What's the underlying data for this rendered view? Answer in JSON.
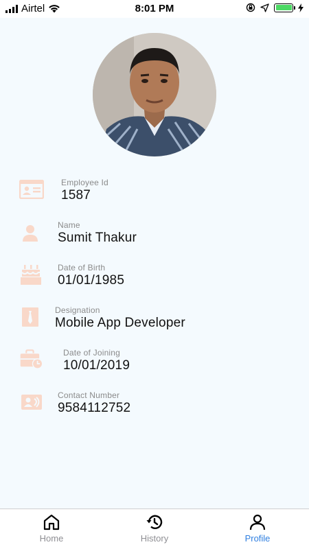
{
  "status_bar": {
    "carrier": "Airtel",
    "time": "8:01 PM"
  },
  "colors": {
    "icon_tint": "#f9d8c9",
    "tab_active": "#2f7fe0",
    "background": "#f4fafe"
  },
  "profile": {
    "avatar_icon": "profile-photo",
    "fields": [
      {
        "label": "Employee Id",
        "value": "1587",
        "icon": "id-card-icon"
      },
      {
        "label": "Name",
        "value": "Sumit Thakur",
        "icon": "person-icon"
      },
      {
        "label": "Date of Birth",
        "value": "01/01/1985",
        "icon": "birthday-cake-icon"
      },
      {
        "label": "Designation",
        "value": "Mobile App Developer",
        "icon": "tie-icon"
      },
      {
        "label": "Date of Joining",
        "value": "10/01/2019",
        "icon": "briefcase-clock-icon"
      },
      {
        "label": "Contact Number",
        "value": "9584112752",
        "icon": "contact-card-icon"
      }
    ]
  },
  "tab_bar": {
    "tabs": [
      {
        "label": "Home",
        "icon": "home-icon",
        "active": false
      },
      {
        "label": "History",
        "icon": "history-icon",
        "active": false
      },
      {
        "label": "Profile",
        "icon": "person-outline-icon",
        "active": true
      }
    ]
  }
}
